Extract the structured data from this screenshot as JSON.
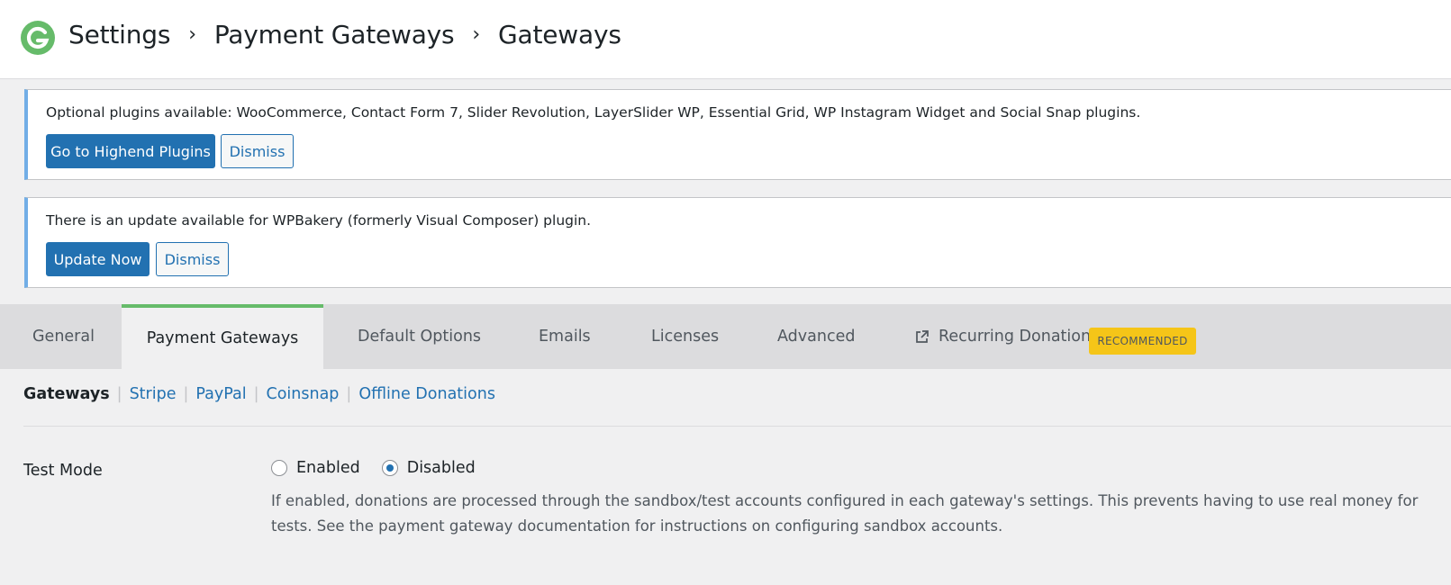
{
  "header": {
    "breadcrumb": [
      "Settings",
      "Payment Gateways",
      "Gateways"
    ],
    "separator": "›",
    "brand_color": "#66bb6a"
  },
  "notices": [
    {
      "text": "Optional plugins available: WooCommerce, Contact Form 7, Slider Revolution, LayerSlider WP, Essential Grid, WP Instagram Widget and Social Snap plugins.",
      "primary_label": "Go to Highend Plugins",
      "dismiss_label": "Dismiss"
    },
    {
      "text": "There is an update available for WPBakery (formerly Visual Composer) plugin.",
      "primary_label": "Update Now",
      "dismiss_label": "Dismiss"
    }
  ],
  "tabs": [
    {
      "label": "General"
    },
    {
      "label": "Payment Gateways",
      "active": true
    },
    {
      "label": "Default Options"
    },
    {
      "label": "Emails"
    },
    {
      "label": "Licenses"
    },
    {
      "label": "Advanced"
    },
    {
      "label": "Recurring Donations",
      "icon": "external-link-icon",
      "badge": "RECOMMENDED"
    }
  ],
  "subnav": {
    "current": "Gateways",
    "links": [
      "Stripe",
      "PayPal",
      "Coinsnap",
      "Offline Donations"
    ]
  },
  "test_mode": {
    "label": "Test Mode",
    "options": [
      "Enabled",
      "Disabled"
    ],
    "selected": "Disabled",
    "description": "If enabled, donations are processed through the sandbox/test accounts configured in each gateway's settings. This prevents having to use real money for tests. See the payment gateway documentation for instructions on configuring sandbox accounts."
  },
  "colors": {
    "accent": "#2271b1",
    "active_tab_border": "#66bb6a",
    "badge_bg": "#f5c518"
  }
}
